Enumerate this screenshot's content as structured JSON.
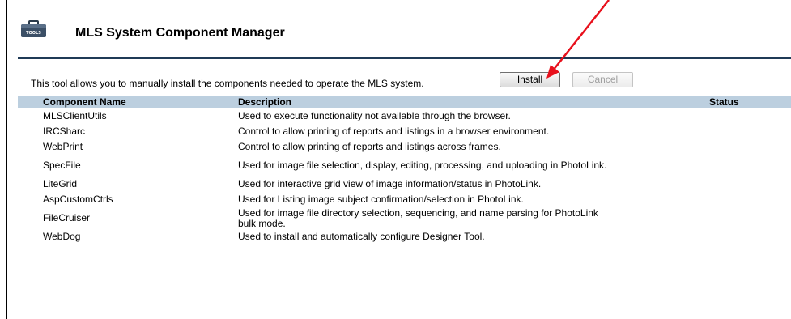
{
  "header": {
    "title": "MLS System Component Manager",
    "icon_label": "TOOLS"
  },
  "intro_text": "This tool allows you to manually install the components needed to operate the MLS system.",
  "buttons": {
    "install": "Install",
    "cancel": "Cancel"
  },
  "table": {
    "columns": [
      "Component Name",
      "Description",
      "Status"
    ],
    "rows": [
      {
        "name": "MLSClientUtils",
        "description": "Used to execute functionality not available through the browser.",
        "status": ""
      },
      {
        "name": "IRCSharc",
        "description": "Control to allow printing of reports and listings in a browser environment.",
        "status": ""
      },
      {
        "name": "WebPrint",
        "description": "Control to allow printing of reports and listings across frames.",
        "status": ""
      },
      {
        "name": "SpecFile",
        "description": "Used for image file selection, display, editing, processing, and uploading in PhotoLink.",
        "status": ""
      },
      {
        "name": "LiteGrid",
        "description": "Used for interactive grid view of image information/status in PhotoLink.",
        "status": ""
      },
      {
        "name": "AspCustomCtrls",
        "description": "Used for Listing image subject confirmation/selection in PhotoLink.",
        "status": ""
      },
      {
        "name": "FileCruiser",
        "description": "Used for image file directory selection, sequencing, and name parsing for PhotoLink bulk mode.",
        "status": ""
      },
      {
        "name": "WebDog",
        "description": "Used to install and automatically configure Designer Tool.",
        "status": ""
      }
    ]
  },
  "colors": {
    "header_rule": "#1f3a56",
    "table_header_bg": "#bccfdf",
    "annotation_arrow": "#e8101c"
  }
}
